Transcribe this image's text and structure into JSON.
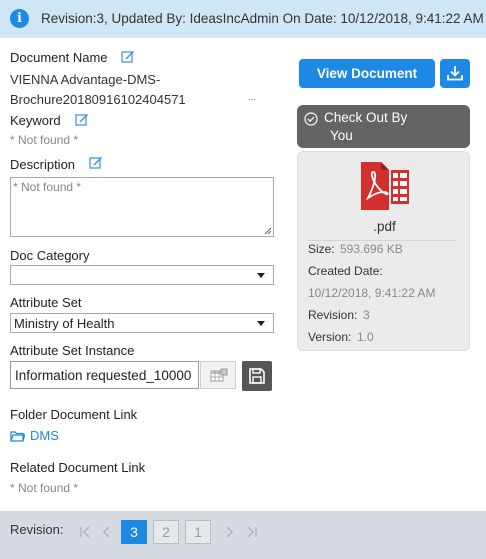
{
  "header": {
    "info_text": "Revision:3, Updated By: IdeasIncAdmin On Date: 10/12/2018, 9:41:22 AM"
  },
  "fields": {
    "document_name_label": "Document Name",
    "document_name_value_line1": "VIENNA Advantage-DMS-",
    "document_name_value_line2": "Brochure20180916102404571",
    "ellipsis": "...",
    "keyword_label": "Keyword",
    "keyword_value": "* Not found *",
    "description_label": "Description",
    "description_placeholder": "* Not found *",
    "doc_category_label": "Doc Category",
    "doc_category_value": "",
    "attribute_set_label": "Attribute Set",
    "attribute_set_value": "Ministry of Health",
    "attribute_set_instance_label": "Attribute Set Instance",
    "attribute_set_instance_value": "Information requested_10000",
    "folder_link_label": "Folder Document Link",
    "folder_link_value": "DMS",
    "related_link_label": "Related Document Link",
    "related_link_value": "* Not found *"
  },
  "side": {
    "view_button": "View Document",
    "checkout_line1": "Check Out By",
    "checkout_line2": "You",
    "file_ext": ".pdf",
    "size_label": "Size:",
    "size_value": "593.696 KB",
    "created_label": "Created Date:",
    "created_value": "10/12/2018, 9:41:22 AM",
    "revision_label": "Revision:",
    "revision_value": "3",
    "version_label": "Version:",
    "version_value": "1.0"
  },
  "footer": {
    "revision_label": "Revision:",
    "pages": [
      "3",
      "2",
      "1"
    ],
    "active_page": "3"
  },
  "colors": {
    "accent": "#1e88e5",
    "header_bg": "#cfe6f6",
    "checkout_bg": "#646464",
    "pdf_red": "#d32f2f",
    "footer_bg": "#d5dbe1"
  },
  "icons": [
    "info-icon",
    "edit-icon",
    "download-icon",
    "check-circle-icon",
    "pdf-file-icon",
    "grid-icon",
    "save-icon",
    "folder-icon",
    "first-page-icon",
    "prev-page-icon",
    "next-page-icon",
    "last-page-icon"
  ]
}
